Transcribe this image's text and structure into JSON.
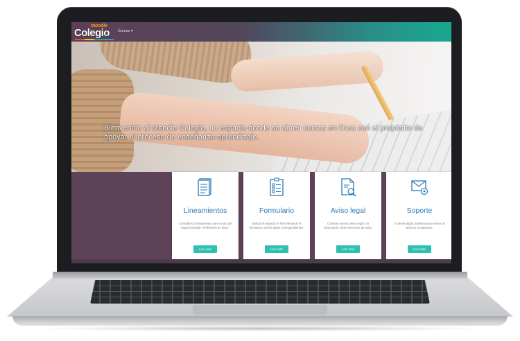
{
  "site": {
    "logo_small": "moodle",
    "logo_main": "Colegio",
    "menu_label": "Cursos ▾"
  },
  "hero": {
    "message": "Bienvenido al Moodle Colegio, un espacio donde se abren cursos en línea con el propósito de apoyar el proceso de enseñanza-aprendizaje."
  },
  "cards": [
    {
      "title": "Lineamientos",
      "icon": "document-icon",
      "description": "Consulta los lineamientos para el uso del espacio Moodle \"Profesores en línea\".",
      "button": "Leer más"
    },
    {
      "title": "Formulario",
      "icon": "checklist-icon",
      "description": "Solicita el espacio en línea llenando el formulario con los datos correspondientes.",
      "button": "Leer más"
    },
    {
      "title": "Aviso legal",
      "icon": "legal-document-icon",
      "description": "Consulta nuestro aviso legal y la información sobre Derechos de autor.",
      "button": "Leer más"
    },
    {
      "title": "Soporte",
      "icon": "mail-settings-icon",
      "description": "Si tienes algún problema para entrar al sistema contáctanos.",
      "button": "Leer más"
    }
  ],
  "colors": {
    "header_start": "#5d4057",
    "header_end": "#18a98f",
    "card_title": "#2a7ab5",
    "button": "#2ec0b0",
    "page_background": "#5e4258"
  }
}
